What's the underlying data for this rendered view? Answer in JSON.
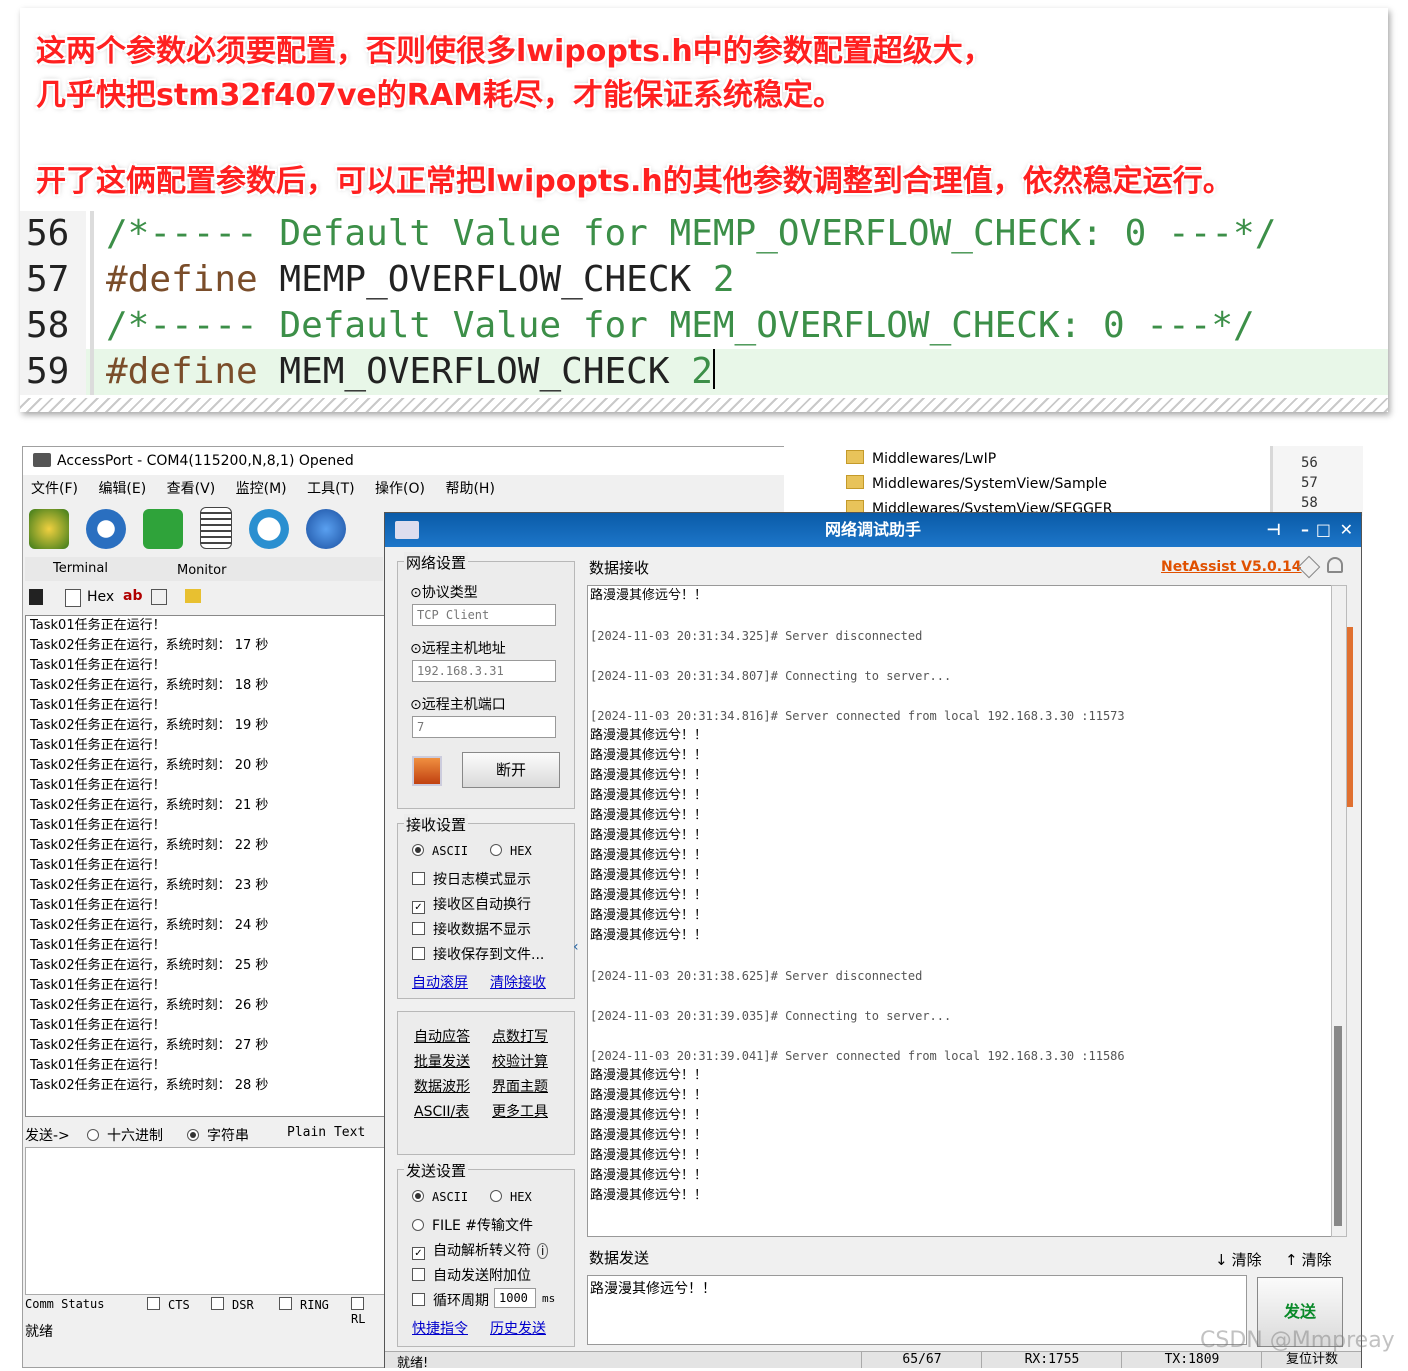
{
  "annotation": {
    "line1": "这两个参数必须要配置，否则使很多lwipopts.h中的参数配置超级大，",
    "line2": "几乎快把stm32f407ve的RAM耗尽，才能保证系统稳定。",
    "line3": "开了这俩配置参数后，可以正常把lwipopts.h的其他参数调整到合理值，依然稳定运行。",
    "code": [
      {
        "ln": "56",
        "a": "/*----- Default Value for MEMP_OVERFLOW_CHECK: 0 ---*/"
      },
      {
        "ln": "57",
        "kw": "#define",
        "name": " MEMP_OVERFLOW_CHECK ",
        "val": "2"
      },
      {
        "ln": "58",
        "a": "/*----- Default Value for MEM_OVERFLOW_CHECK: 0 ---*/"
      },
      {
        "ln": "59",
        "kw": "#define",
        "name": " MEM_OVERFLOW_CHECK ",
        "val": "2"
      }
    ]
  },
  "accessport": {
    "title": "AccessPort - COM4(115200,N,8,1) Opened",
    "menu": [
      "文件(F)",
      "编辑(E)",
      "查看(V)",
      "监控(M)",
      "工具(T)",
      "操作(O)",
      "帮助(H)"
    ],
    "tabs": [
      "Terminal",
      "Monitor"
    ],
    "hex_label": "Hex",
    "ab_label": "ab",
    "terminal_lines": [
      "Task01任务正在运行！",
      "Task02任务正在运行，系统时刻： 17 秒",
      "Task01任务正在运行！",
      "Task02任务正在运行，系统时刻： 18 秒",
      "Task01任务正在运行！",
      "Task02任务正在运行，系统时刻： 19 秒",
      "Task01任务正在运行！",
      "Task02任务正在运行，系统时刻： 20 秒",
      "Task01任务正在运行！",
      "Task02任务正在运行，系统时刻： 21 秒",
      "Task01任务正在运行！",
      "Task02任务正在运行，系统时刻： 22 秒",
      "Task01任务正在运行！",
      "Task02任务正在运行，系统时刻： 23 秒",
      "Task01任务正在运行！",
      "Task02任务正在运行，系统时刻： 24 秒",
      "Task01任务正在运行！",
      "Task02任务正在运行，系统时刻： 25 秒",
      "Task01任务正在运行！",
      "Task02任务正在运行，系统时刻： 26 秒",
      "Task01任务正在运行！",
      "Task02任务正在运行，系统时刻： 27 秒",
      "Task01任务正在运行！",
      "Task02任务正在运行，系统时刻： 28 秒"
    ],
    "send_label": "发送->",
    "radio_hex": "十六进制",
    "radio_str": "字符串",
    "plain_text": "Plain Text",
    "comm_status": "Comm Status",
    "signals": [
      "CTS",
      "DSR",
      "RING",
      "RL"
    ],
    "status": "就绪"
  },
  "tree": {
    "items": [
      "Middlewares/LwIP",
      "Middlewares/SystemView/Sample",
      "Middlewares/SystemView/SEGGER"
    ],
    "lines": [
      "56",
      "57",
      "58"
    ]
  },
  "netassist": {
    "title": "网络调试助手",
    "version": "NetAssist V5.0.14",
    "net_settings": "网络设置",
    "protocol_label": "⊙协议类型",
    "protocol_value": "TCP Client",
    "host_label": "⊙远程主机地址",
    "host_value": "192.168.3.31",
    "port_label": "⊙远程主机端口",
    "port_value": "7",
    "disconnect_btn": "断开",
    "recv_settings": "接收设置",
    "ascii": "ASCII",
    "hex": "HEX",
    "recv_opts": [
      "按日志模式显示",
      "接收区自动换行",
      "接收数据不显示",
      "接收保存到文件..."
    ],
    "auto_scroll": "自动滚屏",
    "clear_recv": "清除接收",
    "tools": [
      "自动应答",
      "点数打写",
      "批量发送",
      "校验计算",
      "数据波形",
      "界面主题",
      "ASCII/表",
      "更多工具"
    ],
    "send_settings": "发送设置",
    "file_opt": "FILE #传输文件",
    "send_opts": [
      "自动解析转义符",
      "自动发送附加位",
      "循环周期"
    ],
    "cycle_value": "1000",
    "cycle_unit": "ms",
    "quick_cmd": "快捷指令",
    "history": "历史发送",
    "recv_tab": "数据接收",
    "send_tab": "数据发送",
    "clear1": "清除",
    "clear2": "清除",
    "send_btn": "发送",
    "send_text": "路漫漫其修远兮！！",
    "rx_lines": [
      {
        "t": "zh",
        "v": "路漫漫其修远兮！！"
      },
      {
        "t": "blank",
        "v": ""
      },
      {
        "t": "log",
        "v": "[2024-11-03 20:31:34.325]# Server disconnected"
      },
      {
        "t": "blank",
        "v": ""
      },
      {
        "t": "log",
        "v": "[2024-11-03 20:31:34.807]# Connecting to server..."
      },
      {
        "t": "blank",
        "v": ""
      },
      {
        "t": "log",
        "v": "[2024-11-03 20:31:34.816]# Server connected from local 192.168.3.30 :11573"
      },
      {
        "t": "zh",
        "v": "路漫漫其修远兮！！"
      },
      {
        "t": "zh",
        "v": "路漫漫其修远兮！！"
      },
      {
        "t": "zh",
        "v": "路漫漫其修远兮！！"
      },
      {
        "t": "zh",
        "v": "路漫漫其修远兮！！"
      },
      {
        "t": "zh",
        "v": "路漫漫其修远兮！！"
      },
      {
        "t": "zh",
        "v": "路漫漫其修远兮！！"
      },
      {
        "t": "zh",
        "v": "路漫漫其修远兮！！"
      },
      {
        "t": "zh",
        "v": "路漫漫其修远兮！！"
      },
      {
        "t": "zh",
        "v": "路漫漫其修远兮！！"
      },
      {
        "t": "zh",
        "v": "路漫漫其修远兮！！"
      },
      {
        "t": "zh",
        "v": "路漫漫其修远兮！！"
      },
      {
        "t": "blank",
        "v": ""
      },
      {
        "t": "log",
        "v": "[2024-11-03 20:31:38.625]# Server disconnected"
      },
      {
        "t": "blank",
        "v": ""
      },
      {
        "t": "log",
        "v": "[2024-11-03 20:31:39.035]# Connecting to server..."
      },
      {
        "t": "blank",
        "v": ""
      },
      {
        "t": "log",
        "v": "[2024-11-03 20:31:39.041]# Server connected from local 192.168.3.30 :11586"
      },
      {
        "t": "zh",
        "v": "路漫漫其修远兮！！"
      },
      {
        "t": "zh",
        "v": "路漫漫其修远兮！！"
      },
      {
        "t": "zh",
        "v": "路漫漫其修远兮！！"
      },
      {
        "t": "zh",
        "v": "路漫漫其修远兮！！"
      },
      {
        "t": "zh",
        "v": "路漫漫其修远兮！！"
      },
      {
        "t": "zh",
        "v": "路漫漫其修远兮！！"
      },
      {
        "t": "zh",
        "v": "路漫漫其修远兮！！"
      }
    ],
    "status_ready": "就绪!",
    "count": "65/67",
    "rx": "RX:1755",
    "tx": "TX:1809",
    "reset": "复位计数"
  },
  "watermark": "CSDN @Mmpreay"
}
